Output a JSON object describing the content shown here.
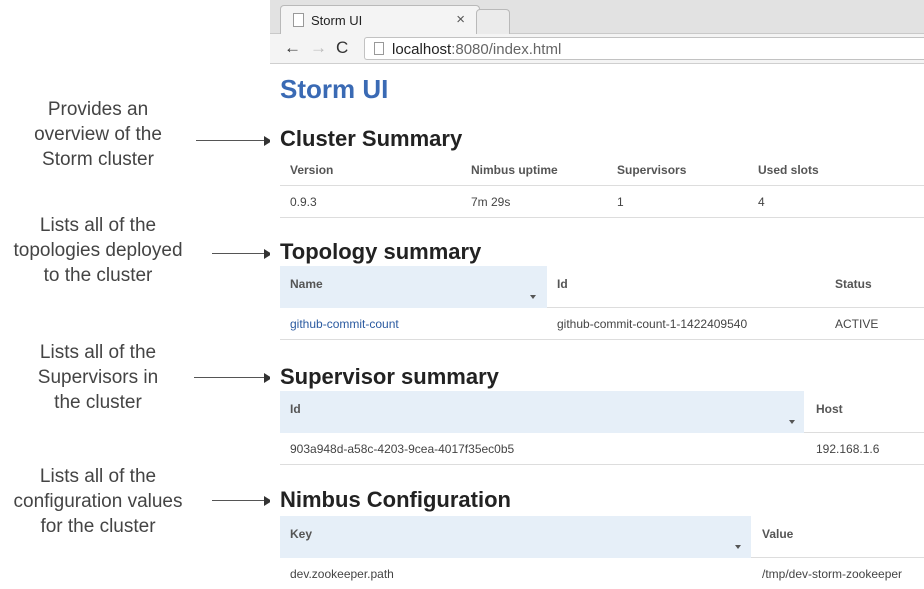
{
  "annotations": [
    {
      "lines": [
        "Provides an",
        "overview of the",
        "Storm cluster"
      ]
    },
    {
      "lines": [
        "Lists all of the",
        "topologies deployed",
        "to the cluster"
      ]
    },
    {
      "lines": [
        "Lists all of the",
        "Supervisors in",
        "the cluster"
      ]
    },
    {
      "lines": [
        "Lists all of the",
        "configuration values",
        "for the cluster"
      ]
    }
  ],
  "browser": {
    "tab_title": "Storm UI",
    "tab_close": "×",
    "nav": {
      "back": "←",
      "forward": "→",
      "reload": "C"
    },
    "url_host": "localhost",
    "url_rest": ":8080/index.html"
  },
  "page": {
    "title": "Storm UI",
    "cluster_summary": {
      "title": "Cluster Summary",
      "headers": [
        "Version",
        "Nimbus uptime",
        "Supervisors",
        "Used slots"
      ],
      "row": [
        "0.9.3",
        "7m 29s",
        "1",
        "4"
      ]
    },
    "topology_summary": {
      "title": "Topology summary",
      "headers": [
        "Name",
        "Id",
        "Status"
      ],
      "row": [
        "github-commit-count",
        "github-commit-count-1-1422409540",
        "ACTIVE"
      ]
    },
    "supervisor_summary": {
      "title": "Supervisor summary",
      "headers": [
        "Id",
        "Host"
      ],
      "row": [
        "903a948d-a58c-4203-9cea-4017f35ec0b5",
        "192.168.1.6"
      ]
    },
    "nimbus_configuration": {
      "title": "Nimbus Configuration",
      "headers": [
        "Key",
        "Value"
      ],
      "row": [
        "dev.zookeeper.path",
        "/tmp/dev-storm-zookeeper"
      ]
    }
  }
}
